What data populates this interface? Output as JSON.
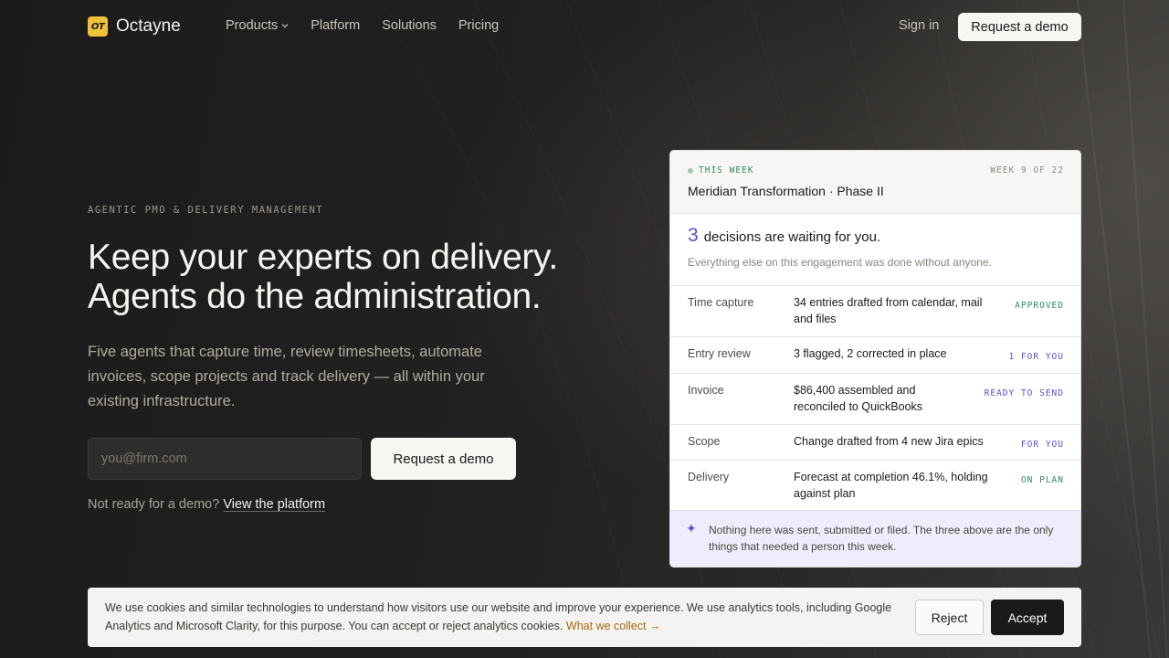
{
  "brand": {
    "logo_mark": "OT",
    "name": "Octayne"
  },
  "nav": {
    "items": [
      {
        "label": "Products",
        "has_dropdown": true
      },
      {
        "label": "Platform"
      },
      {
        "label": "Solutions"
      },
      {
        "label": "Pricing"
      }
    ],
    "sign_in": "Sign in",
    "cta": "Request a demo"
  },
  "hero": {
    "eyebrow": "AGENTIC PMO & DELIVERY MANAGEMENT",
    "headline_line1": "Keep your experts on delivery.",
    "headline_line2": "Agents do the administration.",
    "subcopy": "Five agents that capture time, review timesheets, automate invoices, scope projects and track delivery — all within your existing infrastructure.",
    "email_placeholder": "you@firm.com",
    "cta": "Request a demo",
    "not_ready": "Not ready for a demo?",
    "platform_link": "View the platform"
  },
  "card": {
    "tag": "THIS WEEK",
    "week": "WEEK 9 OF 22",
    "engagement": "Meridian Transformation · Phase II",
    "decisions_count": "3",
    "decisions_text": "decisions are waiting for you.",
    "decisions_sub": "Everything else on this engagement was done without anyone.",
    "rows": [
      {
        "label": "Time capture",
        "text": "34 entries drafted from calendar, mail and files",
        "status": "APPROVED",
        "status_color": "#2e8b62"
      },
      {
        "label": "Entry review",
        "text": "3 flagged, 2 corrected in place",
        "status": "1 FOR YOU",
        "status_color": "#5b4fd0"
      },
      {
        "label": "Invoice",
        "text": "$86,400 assembled and reconciled to QuickBooks",
        "status": "READY TO SEND",
        "status_color": "#5b4fd0"
      },
      {
        "label": "Scope",
        "text": "Change drafted from 4 new Jira epics",
        "status": "FOR YOU",
        "status_color": "#5b4fd0"
      },
      {
        "label": "Delivery",
        "text": "Forecast at completion 46.1%, holding against plan",
        "status": "ON PLAN",
        "status_color": "#2e8b62"
      }
    ],
    "footer_icon": "sparkle-icon",
    "footer": "Nothing here was sent, submitted or filed. The three above are the only things that needed a person this week."
  },
  "cookie": {
    "text": "We use cookies and similar technologies to understand how visitors use our website and improve your experience. We use analytics tools, including Google Analytics and Microsoft Clarity, for this purpose. You can accept or reject analytics cookies.",
    "link": "What we collect →",
    "reject": "Reject",
    "accept": "Accept"
  }
}
